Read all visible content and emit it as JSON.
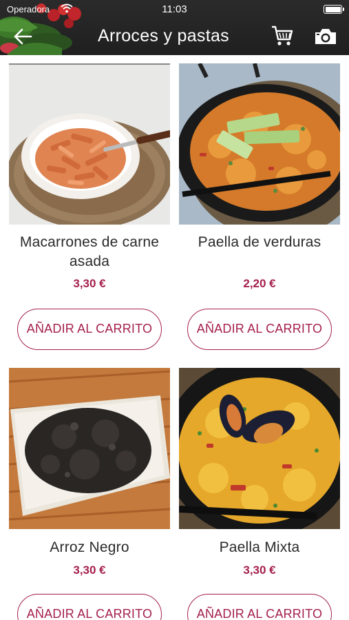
{
  "status_bar": {
    "carrier": "Operadora",
    "time": "11:03"
  },
  "header": {
    "title": "Arroces y pastas"
  },
  "colors": {
    "accent": "#a41f4b",
    "header_bg": "#222222"
  },
  "products": [
    {
      "name": "Macarrones de carne asada",
      "price": "3,30 €",
      "button": "AÑADIR AL CARRITO"
    },
    {
      "name": "Paella de verduras",
      "price": "2,20 €",
      "button": "AÑADIR AL CARRITO"
    },
    {
      "name": "Arroz Negro",
      "price": "3,30 €",
      "button": "AÑADIR AL CARRITO"
    },
    {
      "name": "Paella Mixta",
      "price": "3,30 €",
      "button": "AÑADIR AL CARRITO"
    }
  ]
}
